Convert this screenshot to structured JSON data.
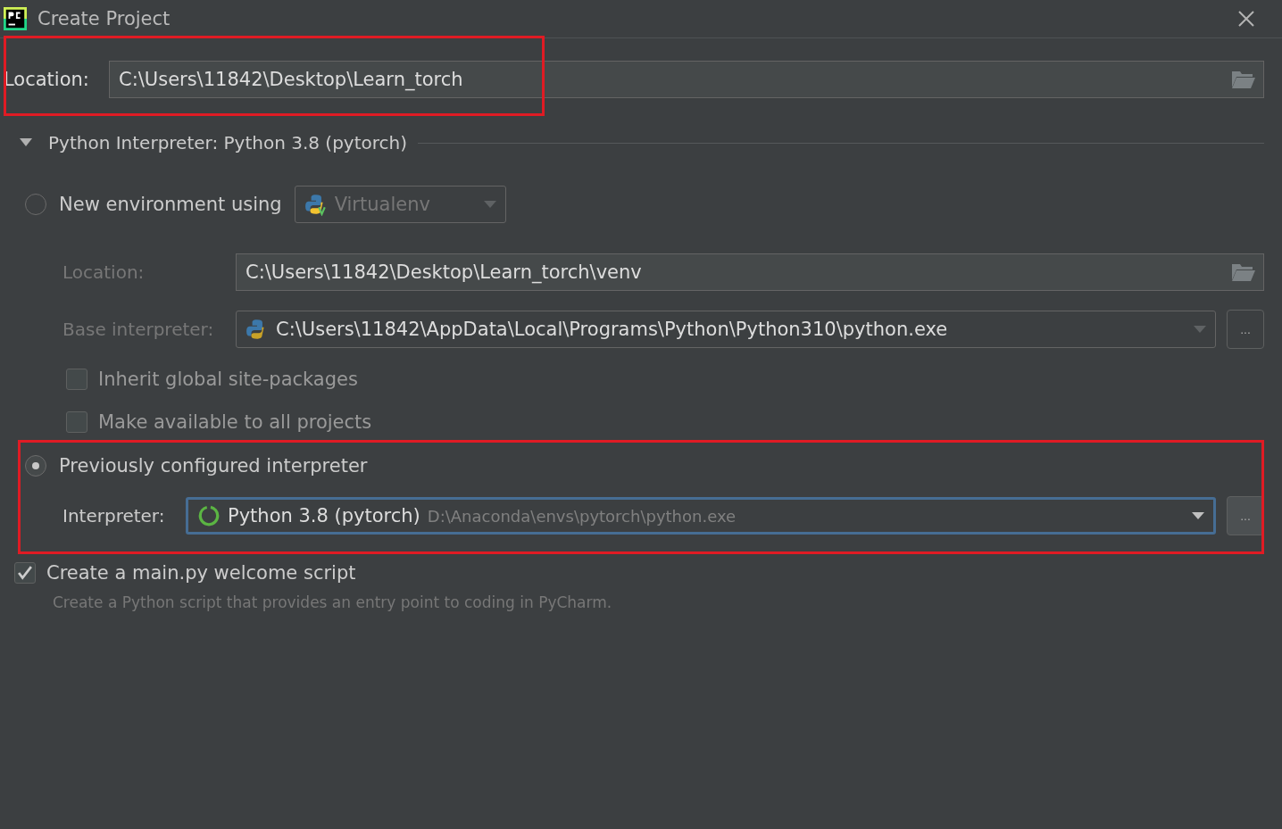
{
  "window": {
    "title": "Create Project"
  },
  "location": {
    "label": "Location:",
    "value": "C:\\Users\\11842\\Desktop\\Learn_torch"
  },
  "interpreter_section": {
    "title": "Python Interpreter: Python 3.8 (pytorch)",
    "expanded": true
  },
  "new_environment": {
    "label": "New environment using",
    "selected": false,
    "tool": "Virtualenv",
    "location_label": "Location:",
    "location_value": "C:\\Users\\11842\\Desktop\\Learn_torch\\venv",
    "base_label": "Base interpreter:",
    "base_value": "C:\\Users\\11842\\AppData\\Local\\Programs\\Python\\Python310\\python.exe",
    "browse": "...",
    "options": [
      {
        "label": "Inherit global site-packages",
        "checked": false
      },
      {
        "label": "Make available to all projects",
        "checked": false
      }
    ]
  },
  "previous": {
    "label": "Previously configured interpreter",
    "selected": true,
    "interpreter_label": "Interpreter:",
    "interpreter_name": "Python 3.8 (pytorch)",
    "interpreter_path": "D:\\Anaconda\\envs\\pytorch\\python.exe",
    "browse": "..."
  },
  "welcome_script": {
    "label": "Create a main.py welcome script",
    "checked": true,
    "description": "Create a Python script that provides an entry point to coding in PyCharm."
  }
}
